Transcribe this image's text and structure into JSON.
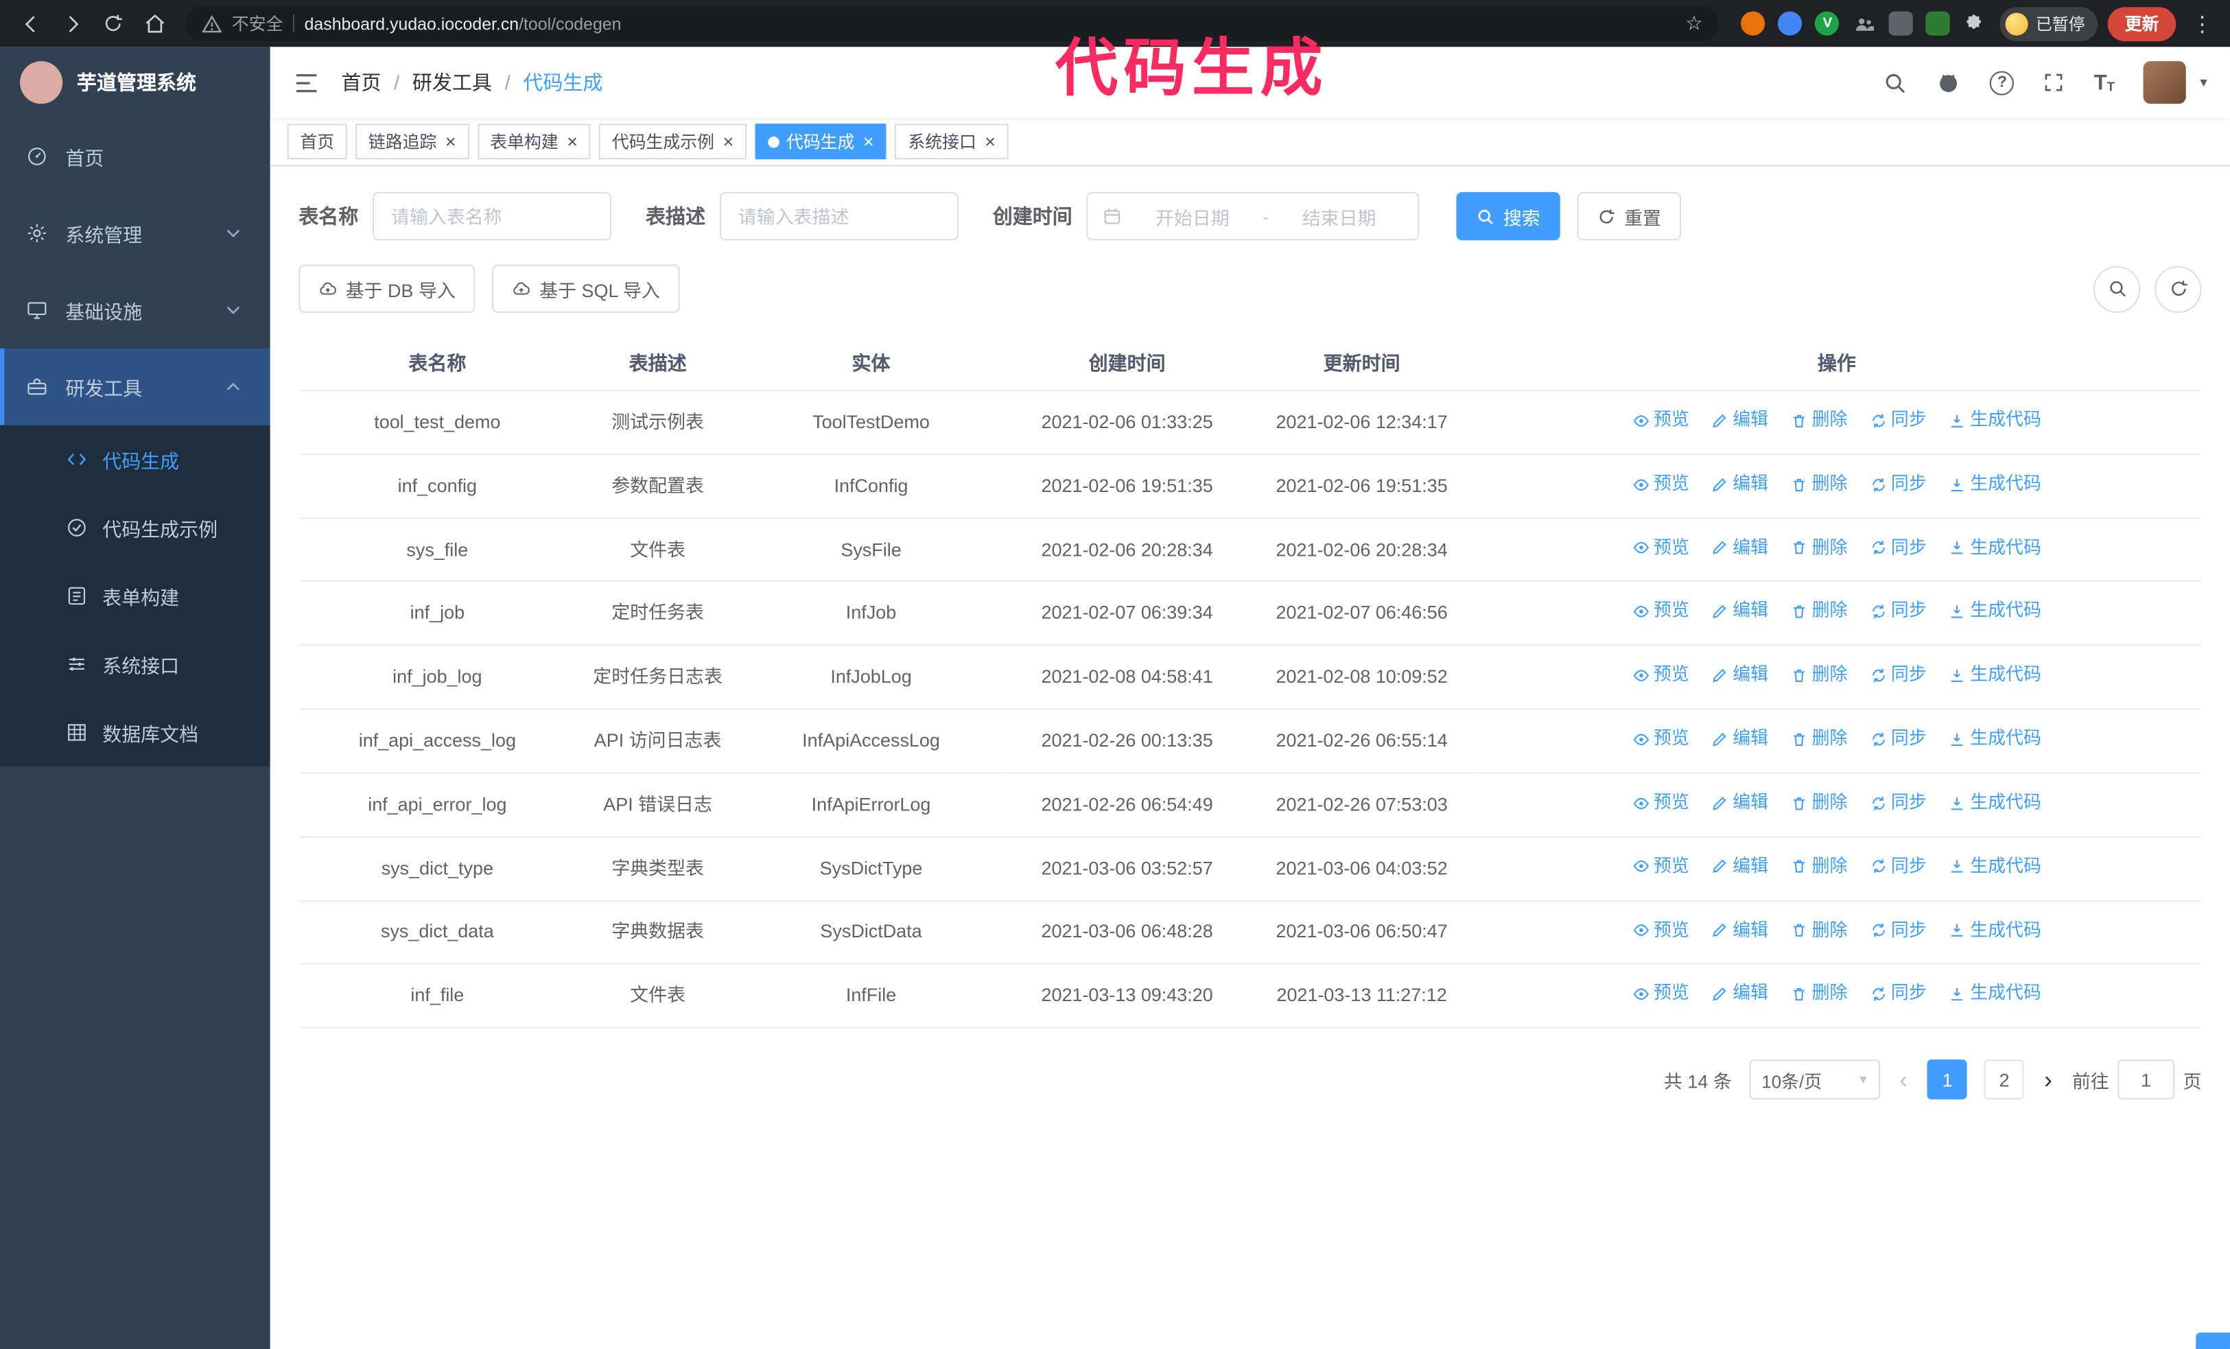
{
  "annotation": {
    "text": "代码生成",
    "color": "#fb2b61"
  },
  "browser": {
    "security_label": "不安全",
    "url_host": "dashboard.yudao.iocoder.cn",
    "url_path": "/tool/codegen",
    "paused_badge": "已暂停",
    "update_button": "更新",
    "extension_green_letter": "V"
  },
  "glyphs": {
    "close": "×",
    "more": "⋮",
    "caret": "▾",
    "star": "☆",
    "prev": "‹",
    "next": "›",
    "breadcrumb_sep": "/",
    "help": "?",
    "font_icon": "T"
  },
  "icons": {
    "search": "magnifier",
    "github": "octocat",
    "help": "question-circle",
    "fullscreen": "corner-brackets",
    "font_size": "double-T",
    "collapse": "hamburger",
    "calendar": "calendar",
    "import": "cloud-upload",
    "preview": "eye",
    "edit": "pencil",
    "delete": "trash",
    "sync": "circular-arrows",
    "generate": "download-arrow",
    "refresh": "circular-arrow"
  },
  "sidebar": {
    "logo_title": "芋道管理系统",
    "items": [
      {
        "label": "首页",
        "icon": "dashboard-icon",
        "active": false
      },
      {
        "label": "系统管理",
        "icon": "gear-icon",
        "expandable": true,
        "expanded": false
      },
      {
        "label": "基础设施",
        "icon": "monitor-icon",
        "expandable": true,
        "expanded": false
      },
      {
        "label": "研发工具",
        "icon": "toolbox-icon",
        "expandable": true,
        "expanded": true,
        "active": true,
        "children": [
          {
            "label": "代码生成",
            "icon": "code-icon",
            "active": true
          },
          {
            "label": "代码生成示例",
            "icon": "example-icon",
            "active": false
          },
          {
            "label": "表单构建",
            "icon": "form-icon",
            "active": false
          },
          {
            "label": "系统接口",
            "icon": "api-icon",
            "active": false
          },
          {
            "label": "数据库文档",
            "icon": "db-doc-icon",
            "active": false
          }
        ]
      }
    ]
  },
  "header": {
    "breadcrumb": [
      "首页",
      "研发工具",
      "代码生成"
    ]
  },
  "tabs": [
    {
      "label": "首页",
      "closable": false,
      "active": false
    },
    {
      "label": "链路追踪",
      "closable": true,
      "active": false
    },
    {
      "label": "表单构建",
      "closable": true,
      "active": false
    },
    {
      "label": "代码生成示例",
      "closable": true,
      "active": false
    },
    {
      "label": "代码生成",
      "closable": true,
      "active": true
    },
    {
      "label": "系统接口",
      "closable": true,
      "active": false
    }
  ],
  "filters": {
    "table_name_label": "表名称",
    "table_name_placeholder": "请输入表名称",
    "table_desc_label": "表描述",
    "table_desc_placeholder": "请输入表描述",
    "create_time_label": "创建时间",
    "date_start_placeholder": "开始日期",
    "date_separator": "-",
    "date_end_placeholder": "结束日期",
    "search_button": "搜索",
    "reset_button": "重置"
  },
  "toolbar": {
    "import_db": "基于 DB 导入",
    "import_sql": "基于 SQL 导入"
  },
  "table": {
    "columns": [
      "表名称",
      "表描述",
      "实体",
      "创建时间",
      "更新时间",
      "操作"
    ],
    "actions": [
      "预览",
      "编辑",
      "删除",
      "同步",
      "生成代码"
    ],
    "rows": [
      {
        "name": "tool_test_demo",
        "desc": "测试示例表",
        "entity": "ToolTestDemo",
        "created": "2021-02-06 01:33:25",
        "updated": "2021-02-06 12:34:17"
      },
      {
        "name": "inf_config",
        "desc": "参数配置表",
        "entity": "InfConfig",
        "created": "2021-02-06 19:51:35",
        "updated": "2021-02-06 19:51:35"
      },
      {
        "name": "sys_file",
        "desc": "文件表",
        "entity": "SysFile",
        "created": "2021-02-06 20:28:34",
        "updated": "2021-02-06 20:28:34"
      },
      {
        "name": "inf_job",
        "desc": "定时任务表",
        "entity": "InfJob",
        "created": "2021-02-07 06:39:34",
        "updated": "2021-02-07 06:46:56"
      },
      {
        "name": "inf_job_log",
        "desc": "定时任务日志表",
        "entity": "InfJobLog",
        "created": "2021-02-08 04:58:41",
        "updated": "2021-02-08 10:09:52"
      },
      {
        "name": "inf_api_access_log",
        "desc": "API 访问日志表",
        "entity": "InfApiAccessLog",
        "created": "2021-02-26 00:13:35",
        "updated": "2021-02-26 06:55:14"
      },
      {
        "name": "inf_api_error_log",
        "desc": "API 错误日志",
        "entity": "InfApiErrorLog",
        "created": "2021-02-26 06:54:49",
        "updated": "2021-02-26 07:53:03"
      },
      {
        "name": "sys_dict_type",
        "desc": "字典类型表",
        "entity": "SysDictType",
        "created": "2021-03-06 03:52:57",
        "updated": "2021-03-06 04:03:52"
      },
      {
        "name": "sys_dict_data",
        "desc": "字典数据表",
        "entity": "SysDictData",
        "created": "2021-03-06 06:48:28",
        "updated": "2021-03-06 06:50:47"
      },
      {
        "name": "inf_file",
        "desc": "文件表",
        "entity": "InfFile",
        "created": "2021-03-13 09:43:20",
        "updated": "2021-03-13 11:27:12"
      }
    ]
  },
  "pagination": {
    "total_text": "共 14 条",
    "page_size": "10条/页",
    "pages": [
      "1",
      "2"
    ],
    "active_page": "1",
    "goto_label": "前往",
    "goto_value": "1",
    "goto_suffix": "页"
  }
}
